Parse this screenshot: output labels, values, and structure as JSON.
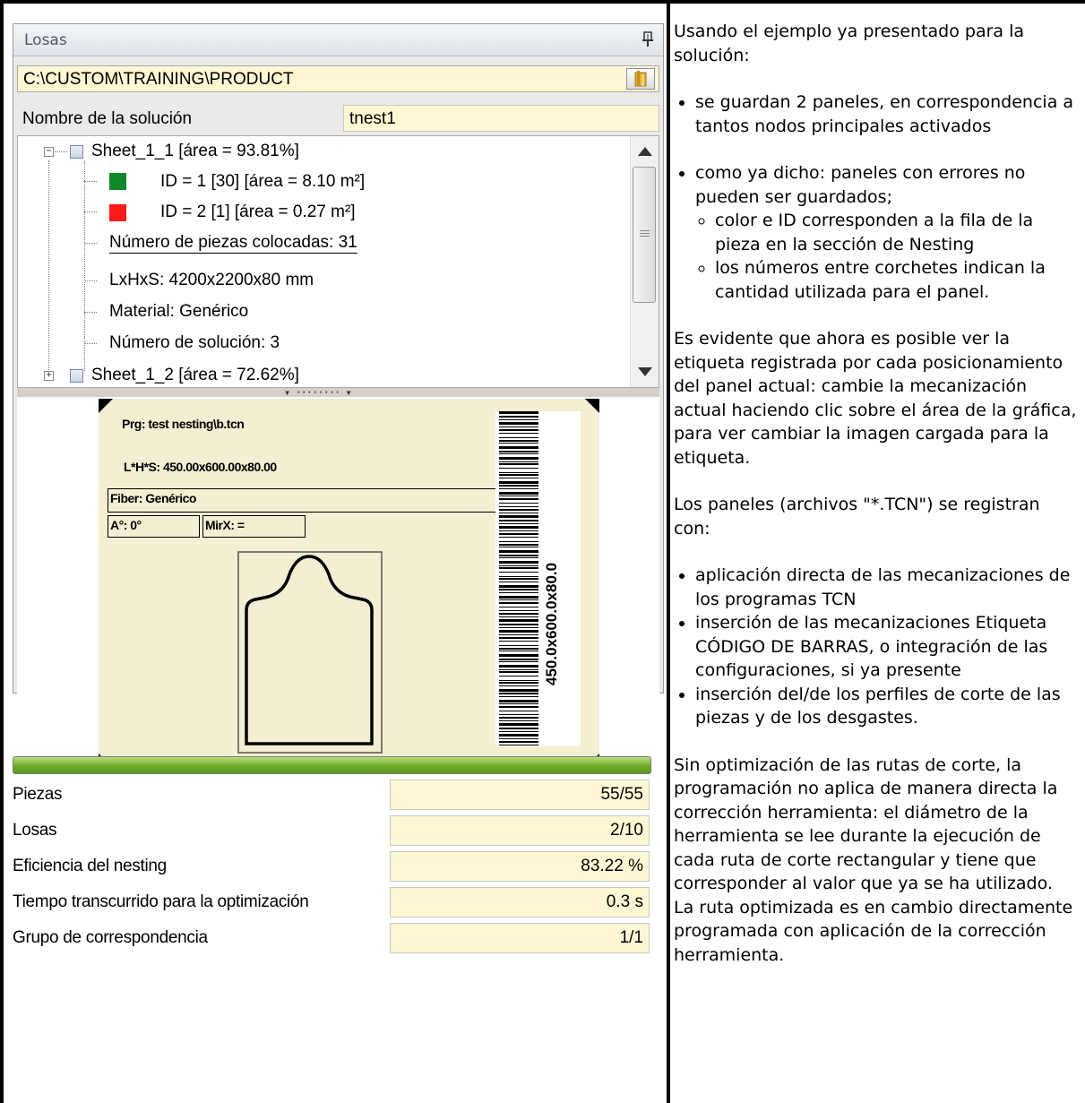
{
  "panel": {
    "title": "Losas",
    "path": "C:\\CUSTOM\\TRAINING\\PRODUCT",
    "name_label": "Nombre de la solución",
    "name_value": "tnest1"
  },
  "tree": {
    "sheet1": "Sheet_1_1 [área = 93.81%]",
    "item1": "ID = 1 [30] [área = 8.10 m²]",
    "item1_color": "#0f8a2a",
    "item2": "ID = 2 [1] [área = 0.27 m²]",
    "item2_color": "#ff1a1a",
    "pieces": "Número de piezas colocadas: 31",
    "dims": "LxHxS: 4200x2200x80  mm",
    "material": "Material: Genérico",
    "solution": "Número de solución: 3",
    "sheet2": "Sheet_1_2 [área = 72.62%]"
  },
  "label": {
    "prg": "Prg: test nesting\\b.tcn",
    "lhs": "L*H*S: 450.00x600.00x80.00",
    "fiber": "Fiber: Genérico",
    "angle": "A°: 0°",
    "mirror": "MirX: =",
    "barcode": "450.0x600.0x80.0"
  },
  "progress": {
    "fraction": 1.0
  },
  "stats": [
    {
      "label": "Piezas",
      "value": "55/55"
    },
    {
      "label": "Losas",
      "value": "2/10"
    },
    {
      "label": "Eficiencia del nesting",
      "value": "83.22 %"
    },
    {
      "label": "Tiempo transcurrido para la optimización",
      "value": "0.3 s"
    },
    {
      "label": "Grupo de correspondencia",
      "value": "1/1"
    }
  ],
  "doc": {
    "intro": "Usando el ejemplo ya presentado para la solución:",
    "b1": "se guardan 2 paneles, en correspondencia a tantos nodos principales activados",
    "b2": "como ya dicho: paneles con errores no pueden ser guardados;",
    "b2a": "color e ID corresponden a la fila de la pieza en la sección de Nesting",
    "b2b": "los números entre corchetes indican la cantidad utilizada para el panel.",
    "p2": "Es evidente que ahora es posible ver la etiqueta registrada por cada posicionamiento del panel actual: cambie la mecanización actual haciendo clic sobre el área de la gráfica, para ver cambiar la imagen cargada para la etiqueta.",
    "p3": "Los paneles (archivos \"*.TCN\") se registran con:",
    "b3": "aplicación directa de las mecanizaciones de los programas TCN",
    "b4": "inserción de las mecanizaciones Etiqueta CÓDIGO DE BARRAS, o integración de las configuraciones, si ya presente",
    "b5": "inserción del/de los perfiles de corte de las piezas y de los desgastes.",
    "p4": "Sin optimización de las rutas de corte, la programación no aplica de manera directa la corrección herramienta: el diámetro de la herramienta se lee durante la ejecución de cada ruta de corte rectangular y tiene que corresponder al valor que ya se ha utilizado.",
    "p5": "La ruta optimizada es en cambio directamente programada con aplicación de la corrección herramienta."
  }
}
